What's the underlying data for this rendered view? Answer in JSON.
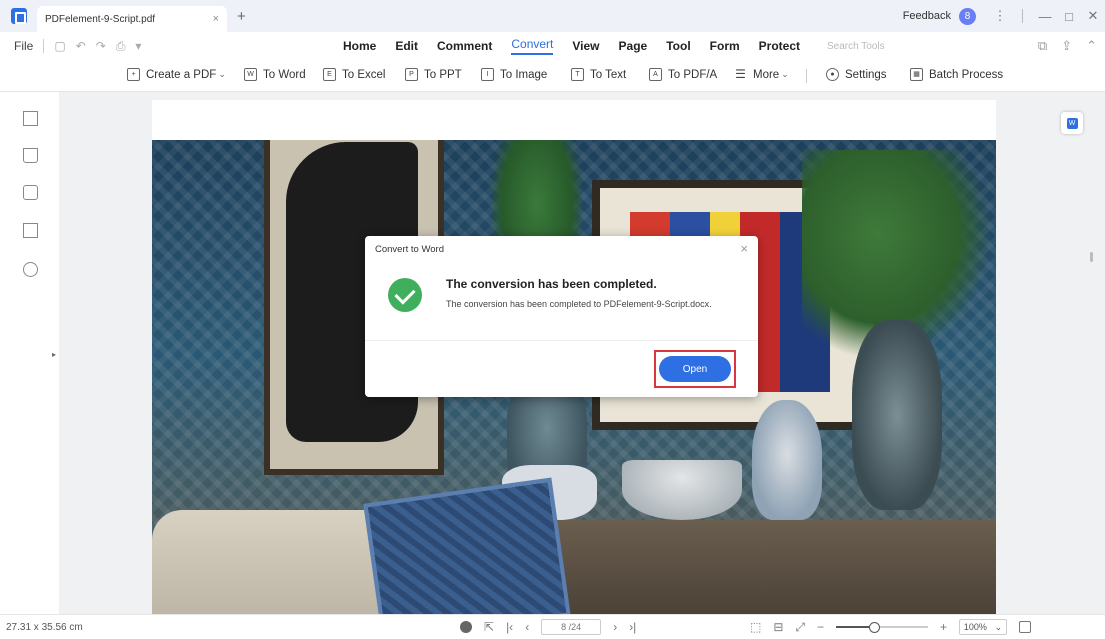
{
  "titlebar": {
    "tab_title": "PDFelement-9-Script.pdf",
    "tab_close": "×",
    "new_tab": "+",
    "feedback": "Feedback",
    "avatar_letter": "8",
    "more": "⋮",
    "minimize": "—",
    "maximize": "□",
    "close": "✕"
  },
  "menu": {
    "file": "File",
    "tabs": [
      "Home",
      "Edit",
      "Comment",
      "Convert",
      "View",
      "Page",
      "Tool",
      "Form",
      "Protect"
    ],
    "active_tab": "Convert",
    "search_placeholder": "Search Tools"
  },
  "toolbar": {
    "create_pdf": "Create a PDF",
    "to_word": "To Word",
    "to_excel": "To Excel",
    "to_ppt": "To PPT",
    "to_image": "To Image",
    "to_text": "To Text",
    "to_pdfa": "To PDF/A",
    "more": "More",
    "settings": "Settings",
    "batch_process": "Batch Process"
  },
  "dialog": {
    "title": "Convert to Word",
    "heading": "The conversion has been completed.",
    "message": "The conversion has been completed to PDFelement-9-Script.docx.",
    "open_button": "Open"
  },
  "status": {
    "page_size": "27.31 x 35.56 cm",
    "page_indicator": "8 /24",
    "zoom": "100%"
  },
  "colors": {
    "accent": "#2f6fe4",
    "success": "#3fae5d",
    "highlight": "#d9363e"
  },
  "icons": [
    "app-logo-icon",
    "thumbnail-icon",
    "bookmark-icon",
    "comment-icon",
    "attachment-icon",
    "search-icon",
    "check-circle-icon",
    "hand-icon",
    "select-icon",
    "fit-page-icon"
  ]
}
